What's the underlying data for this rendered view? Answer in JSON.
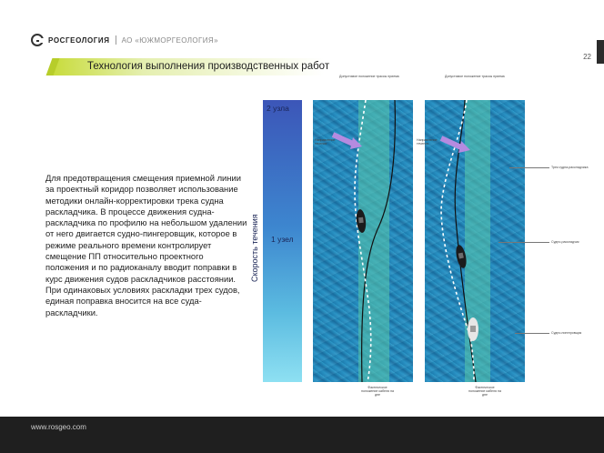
{
  "header": {
    "brand": "РОСГЕОЛОГИЯ",
    "company": "АО «ЮЖМОРГЕОЛОГИЯ»",
    "page_number": "22"
  },
  "title": "Технология выполнения производственных работ",
  "body": {
    "paragraph1": "Для предотвращения смещения приемной линии за проектный коридор позволяет использование методики онлайн-корректировки трека судна раскладчика. В процессе движения судна-раскладчика по профилю на небольшом удалении от него двигается судно-пингеровщик, которое в режиме реального времени контролирует смещение ПП относительно проектного положения и по радиоканалу вводит поправки в курс движения судов раскладчиков расстоянии.",
    "paragraph2": "При одинаковых условиях раскладки трех судов, единая поправка вносится на все суда-раскладчики."
  },
  "speed_scale": {
    "axis_label": "Скорость течения",
    "top_label": "2 узла",
    "mid_label": "1 узел",
    "colors": [
      "#3c56b8",
      "#8ee0f2"
    ]
  },
  "diagram": {
    "left": {
      "top_annotation": "Допустимое положение трассы приема",
      "current_annotation": "Направление течения",
      "bottom_annotation": "Фактическое положение кабеля на дне"
    },
    "right": {
      "top_annotation": "Допустимое положение трассы приема",
      "current_annotation": "Направление течения",
      "bottom_annotation": "Фактическое положение кабеля на дне",
      "side_labels": [
        "Трек судна-раскладчика",
        "Судно-раскладчик",
        "Судно-пингеровщик"
      ]
    }
  },
  "footer": {
    "url": "www.rosgeo.com"
  }
}
